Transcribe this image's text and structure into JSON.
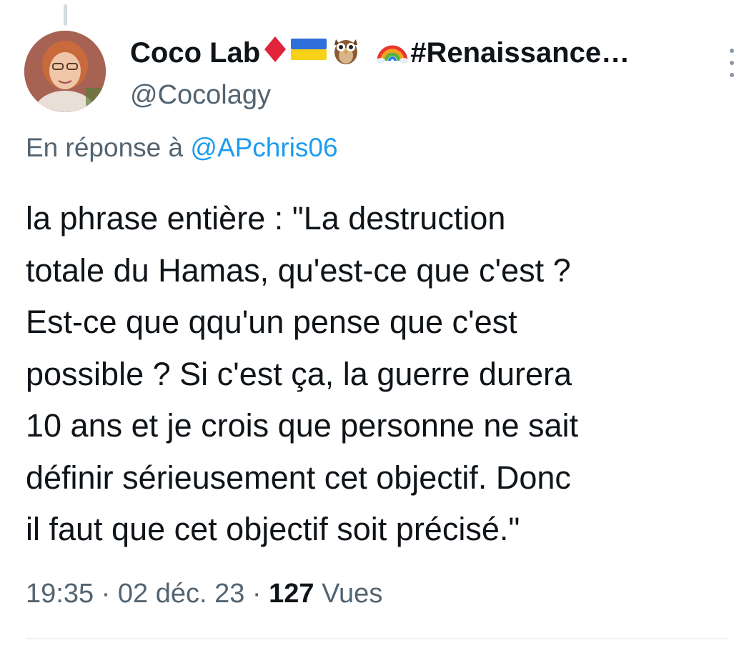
{
  "tweet": {
    "author": {
      "display_name": "Coco Lab",
      "emojis": [
        "red-diamond-icon",
        "ukraine-flag-icon",
        "owl-icon",
        "rainbow-icon"
      ],
      "hashtag_truncated": "#Renaissance…",
      "handle": "@Cocolagy"
    },
    "reply": {
      "prefix": "En réponse à",
      "mention": "@APchris06"
    },
    "text_lines": [
      "la phrase entière : \"La destruction",
      "totale du Hamas, qu'est-ce que c'est ?",
      "Est-ce que qqu'un pense que c'est",
      "possible ? Si c'est ça, la guerre durera",
      "10 ans et je crois que personne ne sait",
      "définir sérieusement cet objectif. Donc",
      "il faut que cet objectif soit précisé.\""
    ],
    "meta": {
      "time": "19:35",
      "separator": "·",
      "date": "02 déc. 23",
      "views_count": "127",
      "views_label": "Vues"
    },
    "more_icon": "more-vertical-icon"
  },
  "colors": {
    "text_primary": "#0f1419",
    "text_secondary": "#536471",
    "link": "#1d9bf0",
    "divider": "#eff3f4"
  }
}
